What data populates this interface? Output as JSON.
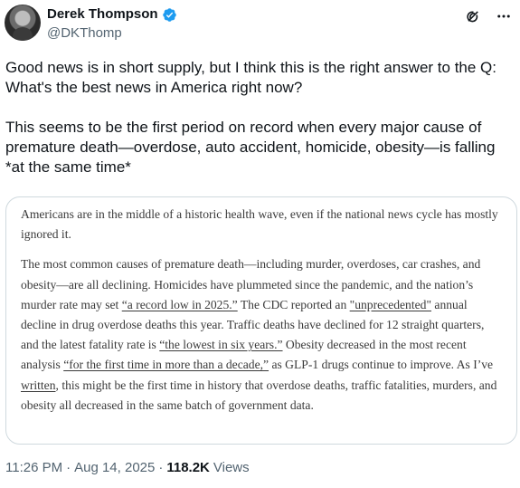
{
  "author": {
    "name": "Derek Thompson",
    "handle": "@DKThomp",
    "verified_color": "#1d9bf0"
  },
  "icons": {
    "grok": "grok-icon",
    "more": "more-icon"
  },
  "tweet": {
    "text": "Good news is in short supply, but I think this is the right answer to the Q: What's the best news in America right now?\n\nThis seems to be the first period on record when every major cause of premature death—overdose, auto accident, homicide, obesity—is falling *at the same time*"
  },
  "card": {
    "p1": "Americans are in the middle of a historic health wave, even if the national news cycle has mostly ignored it.",
    "p2": {
      "s1": "The most common causes of premature death—including murder, overdoses, car crashes, and obesity—are all declining. Homicides have plummeted since the pandemic, and the nation’s murder rate may set ",
      "l1": "“a record low in 2025.”",
      "s2": " The CDC reported an ",
      "l2": "\"unprecedented\"",
      "s3": " annual decline in drug overdose deaths this year. Traffic deaths have declined for 12 straight quarters, and the latest fatality rate is ",
      "l3": "“the lowest in six years.”",
      "s4": " Obesity decreased in the most recent analysis ",
      "l4": "“for the first time in more than a decade,”",
      "s5": " as GLP-1 drugs continue to improve. As I’ve ",
      "l5": "written",
      "s6": ", this might be the first time in history that overdose deaths, traffic fatalities, murders, and obesity all decreased in the same batch of government data."
    }
  },
  "meta": {
    "time": "11:26 PM",
    "sep1": "·",
    "date": "Aug 14, 2025",
    "sep2": "·",
    "views_count": "118.2K",
    "views_label": "Views"
  }
}
